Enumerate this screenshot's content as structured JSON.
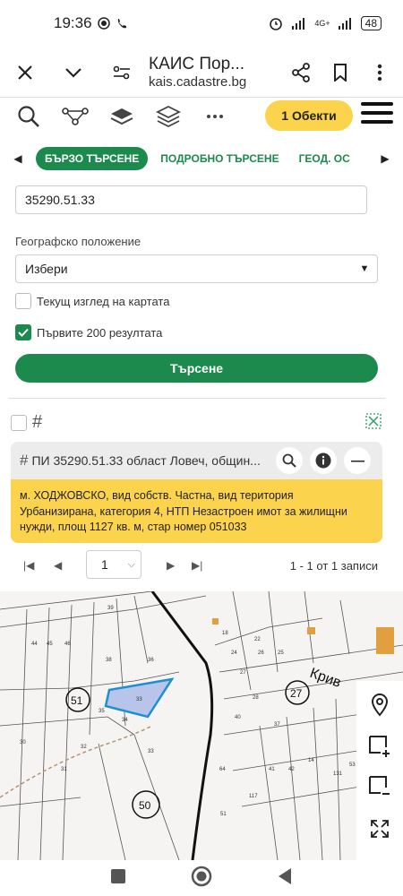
{
  "status": {
    "time": "19:36",
    "battery": "48",
    "network": "4G+"
  },
  "browser": {
    "title": "КАИС Пор...",
    "url": "kais.cadastre.bg"
  },
  "toolbar": {
    "objects_label": "1 Обекти"
  },
  "tabs": [
    {
      "label": "БЪРЗО ТЪРСЕНЕ"
    },
    {
      "label": "ПОДРОБНО ТЪРСЕНЕ"
    },
    {
      "label": "ГЕОД. ОС"
    }
  ],
  "search": {
    "query_value": "35290.51.33",
    "geo_label": "Географско положение",
    "geo_selected": "Избери",
    "current_view_label": "Текущ изглед на картата",
    "first200_label": "Първите 200 резултата",
    "first200_checked": true,
    "current_view_checked": false,
    "submit_label": "Търсене"
  },
  "result": {
    "title": "ПИ 35290.51.33 област Ловеч, общин...",
    "details": "м. ХОДЖОВСКО, вид собств. Частна, вид територия Урбанизирана, категория 4, НТП Незастроен имот за жилищни нужди, площ 1127 кв. м, стар номер 051033"
  },
  "pager": {
    "page": "1",
    "summary": "1 - 1 от 1 записи"
  },
  "map": {
    "street_label": "Крив",
    "region_labels": [
      "51",
      "27",
      "50"
    ],
    "parcel_numbers": [
      "39",
      "37",
      "44",
      "45",
      "46",
      "47",
      "43",
      "38",
      "36",
      "33",
      "34",
      "35",
      "40",
      "32",
      "31",
      "30",
      "29",
      "28",
      "27",
      "26",
      "25",
      "24",
      "23",
      "22",
      "18",
      "5",
      "37",
      "64",
      "41",
      "42",
      "14",
      "51",
      "55",
      "117",
      "131",
      "53",
      "41",
      "40",
      "36",
      "35"
    ],
    "highlight_color": "#b8c4ea"
  }
}
